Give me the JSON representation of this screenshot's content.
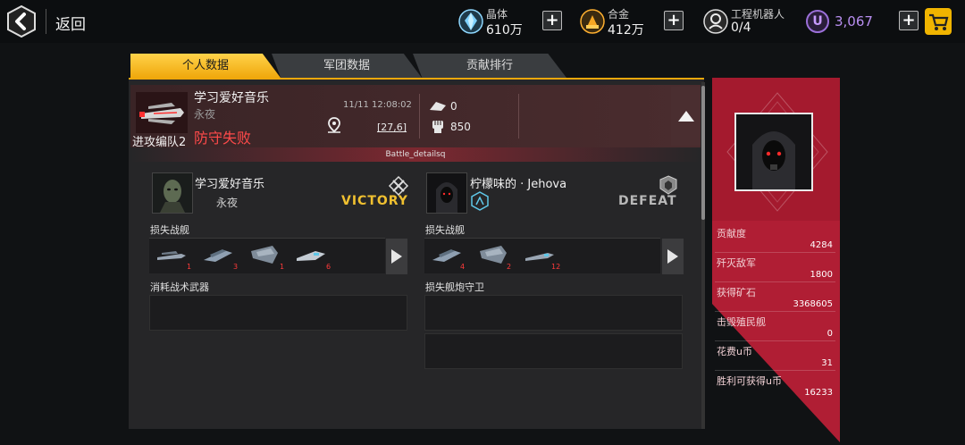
{
  "topbar": {
    "back_label": "返回",
    "crystal": {
      "name": "晶体",
      "value": "610万"
    },
    "alloy": {
      "name": "合金",
      "value": "412万"
    },
    "robots": {
      "name": "工程机器人",
      "value": "0/4"
    },
    "u_coin": {
      "icon_letter": "U",
      "value": "3,067"
    }
  },
  "tabs": [
    "个人数据",
    "军团数据",
    "贡献排行"
  ],
  "report": {
    "fleet_tag": "进攻编队2",
    "player_name": "学习爱好音乐",
    "guild": "永夜",
    "result": "防守失败",
    "time": "11/11 12:08:02",
    "coord": "[27,6]",
    "stat1": "0",
    "stat2": "850"
  },
  "battle_label": "Battle_detailsq",
  "attacker": {
    "name": "学习爱好音乐",
    "guild": "永夜",
    "outcome": "VICTORY",
    "lost_ships_label": "损失战舰",
    "ships": [
      {
        "icon": "ship-icon",
        "count": "1"
      },
      {
        "icon": "ship-icon",
        "count": "3"
      },
      {
        "icon": "ship-icon",
        "count": "1"
      },
      {
        "icon": "ship-icon",
        "count": "6"
      }
    ],
    "weapons_label": "消耗战术武器"
  },
  "defender": {
    "name": "柠檬味的 · Jehova",
    "outcome": "DEFEAT",
    "lost_ships_label": "损失战舰",
    "ships": [
      {
        "icon": "ship-icon",
        "count": "4"
      },
      {
        "icon": "ship-icon",
        "count": "2"
      },
      {
        "icon": "ship-icon",
        "count": "12"
      }
    ],
    "guard_label": "损失舰炮守卫"
  },
  "contribution": {
    "stats": [
      {
        "label": "贡献度",
        "value": "4284"
      },
      {
        "label": "歼灭敌军",
        "value": "1800"
      },
      {
        "label": "获得矿石",
        "value": "3368605"
      },
      {
        "label": "击毁殖民舰",
        "value": "0"
      },
      {
        "label": "花费u币",
        "value": "31"
      },
      {
        "label": "胜利可获得u币",
        "value": "16233"
      }
    ]
  },
  "colors": {
    "accent": "#f0a80c",
    "panel_red": "#b01e34",
    "defeat_red": "#ff4a4a",
    "victory_gold": "#f0c030",
    "u_purple": "#b88ef0"
  }
}
